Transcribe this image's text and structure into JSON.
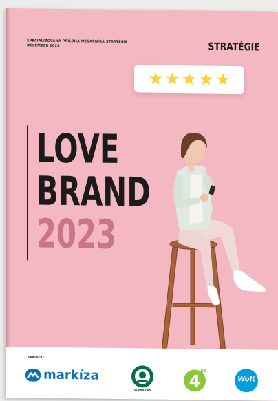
{
  "cover": {
    "subtitle_line1": "ŠPECIALIZOVANÁ PRÍLOHA MESAČNÍKA STRATÉGIE",
    "subtitle_line2": "DECEMBER 2023",
    "brand": "STRATÉGIE",
    "rating": {
      "stars": 5,
      "icon": "star-icon"
    },
    "title_line1": "LOVE",
    "title_line2": "BRAND",
    "title_year": "2023"
  },
  "colors": {
    "background": "#f3b8c2",
    "title": "#1b1b1b",
    "year": "#c9768a",
    "star": "#f5d33a"
  },
  "footer": {
    "partners_label": "PARTNERI:",
    "partners": [
      {
        "name": "markíza",
        "icon": "markiza-logo"
      },
      {
        "name": "STARBUCKS",
        "icon": "starbucks-logo"
      },
      {
        "name": "KA",
        "icon": "four-ka-logo"
      },
      {
        "name": "Wolt",
        "icon": "wolt-logo"
      }
    ]
  }
}
